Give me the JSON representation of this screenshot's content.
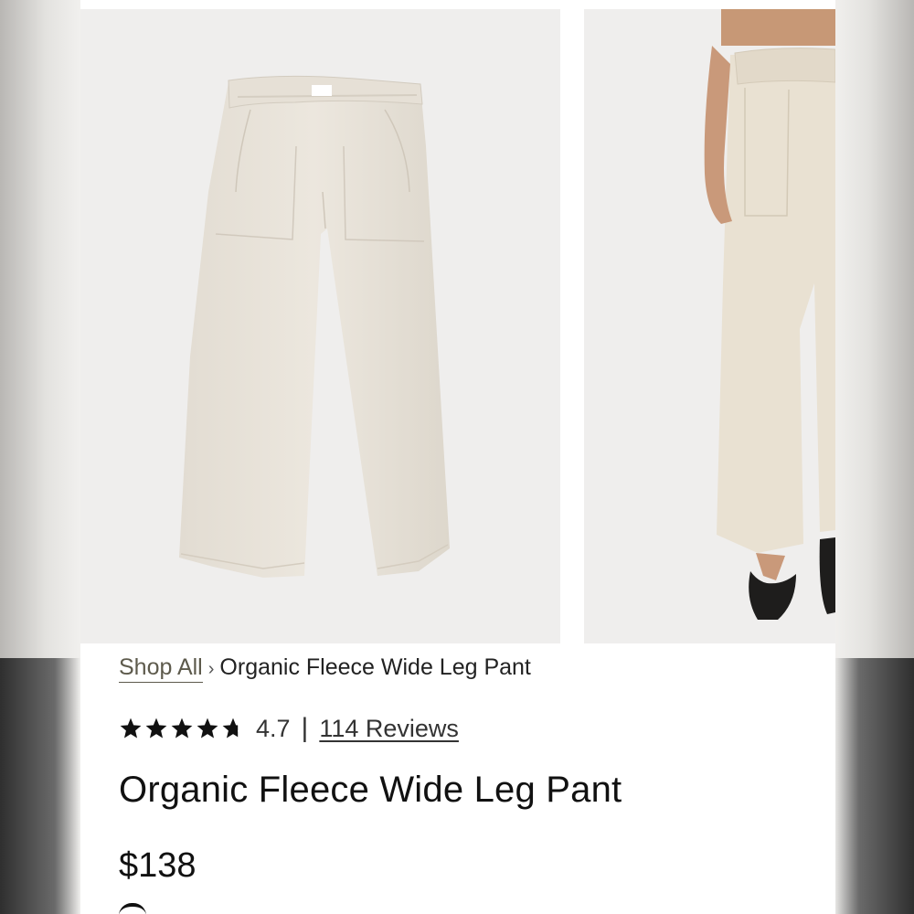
{
  "breadcrumb": {
    "root_label": "Shop All",
    "separator": "›",
    "current_label": "Organic Fleece Wide Leg Pant"
  },
  "rating": {
    "value": "4.7",
    "stars_filled": 4.7,
    "stars_total": 5,
    "divider": "|",
    "reviews_label": "114 Reviews"
  },
  "product": {
    "title": "Organic Fleece Wide Leg Pant",
    "price": "$138",
    "color": "#e9e3d8"
  },
  "gallery": {
    "images": [
      {
        "name": "flat-lay-pant-image"
      },
      {
        "name": "model-wearing-pant-image"
      }
    ]
  },
  "colors": {
    "link": "#5d5a4c",
    "text": "#111111",
    "photo_bg": "#efeeed"
  }
}
